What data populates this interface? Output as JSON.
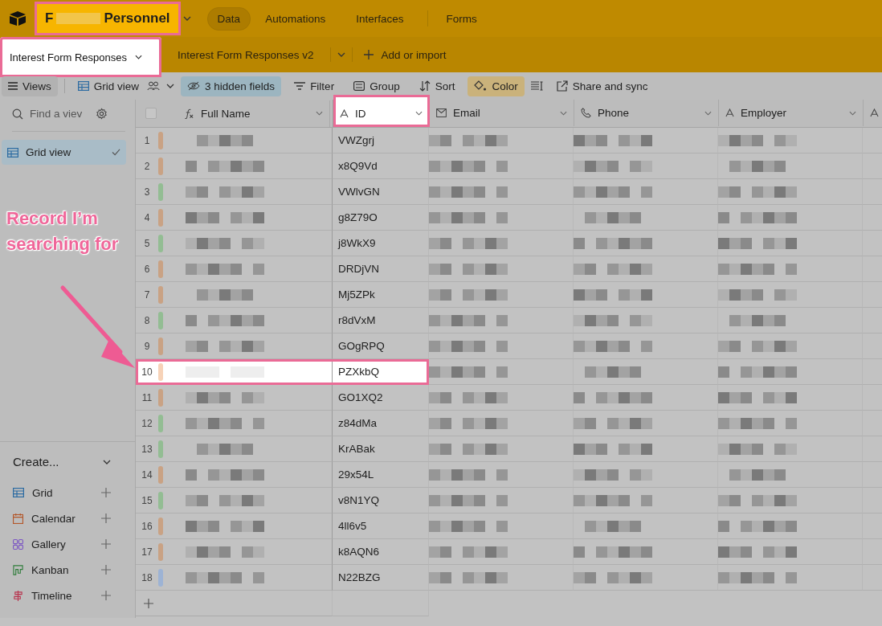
{
  "base": {
    "name_start": "F",
    "name_end": "Personnel",
    "highlighted": true
  },
  "nav": [
    {
      "label": "Data",
      "selected": true
    },
    {
      "label": "Automations",
      "selected": false
    },
    {
      "label": "Interfaces",
      "selected": false
    },
    {
      "label": "Forms",
      "selected": false
    }
  ],
  "tables": [
    {
      "label": "Interest Form Responses",
      "selected": true,
      "highlighted": true
    },
    {
      "label": "Interest Form Responses v2",
      "selected": false,
      "highlighted": false
    }
  ],
  "add_table": "Add or import",
  "toolbar": {
    "views": "Views",
    "view_name": "Grid view",
    "hidden_fields": "3 hidden fields",
    "filter": "Filter",
    "group": "Group",
    "sort": "Sort",
    "color_label": "Color",
    "color_active": true,
    "share": "Share and sync"
  },
  "sidebar": {
    "search_placeholder": "Find a viev",
    "views": [
      {
        "label": "Grid view",
        "selected": true
      }
    ],
    "create_label": "Create...",
    "create_items": [
      {
        "kind": "grid",
        "label": "Grid"
      },
      {
        "kind": "calendar",
        "label": "Calendar"
      },
      {
        "kind": "gallery",
        "label": "Gallery"
      },
      {
        "kind": "kanban",
        "label": "Kanban"
      },
      {
        "kind": "timeline",
        "label": "Timeline"
      }
    ]
  },
  "select_all": {
    "checked": false
  },
  "columns": [
    {
      "kind": "formula",
      "label": "Full Name",
      "highlighted": false
    },
    {
      "kind": "text",
      "label": "ID",
      "highlighted": true
    },
    {
      "kind": "email",
      "label": "Email",
      "highlighted": false
    },
    {
      "kind": "phone",
      "label": "Phone",
      "highlighted": false
    },
    {
      "kind": "text",
      "label": "Employer",
      "highlighted": false
    },
    {
      "kind": "text",
      "highlighted": false
    }
  ],
  "rows": [
    {
      "number": "1",
      "color": "#c9a284",
      "id": "VWZgrj",
      "highlighted": false
    },
    {
      "number": "2",
      "color": "#c9a284",
      "id": "x8Q9Vd",
      "highlighted": false
    },
    {
      "number": "3",
      "color": "#93bd93",
      "id": "VWlvGN",
      "highlighted": false
    },
    {
      "number": "4",
      "color": "#c9a284",
      "id": "g8Z79O",
      "highlighted": false
    },
    {
      "number": "5",
      "color": "#93bd93",
      "id": "j8WkX9",
      "highlighted": false
    },
    {
      "number": "6",
      "color": "#c9a284",
      "id": "DRDjVN",
      "highlighted": false
    },
    {
      "number": "7",
      "color": "#c9a284",
      "id": "Mj5ZPk",
      "highlighted": false
    },
    {
      "number": "8",
      "color": "#93bd93",
      "id": "r8dVxM",
      "highlighted": false
    },
    {
      "number": "9",
      "color": "#c9a284",
      "id": "GOgRPQ",
      "highlighted": false
    },
    {
      "number": "10",
      "color": "#f7d3b8",
      "id": "PZXkbQ",
      "highlighted": true
    },
    {
      "number": "11",
      "color": "#c9a284",
      "id": "GO1XQ2",
      "highlighted": false
    },
    {
      "number": "12",
      "color": "#93bd93",
      "id": "z84dMa",
      "highlighted": false
    },
    {
      "number": "13",
      "color": "#93bd93",
      "id": "KrABak",
      "highlighted": false
    },
    {
      "number": "14",
      "color": "#c9a284",
      "id": "29x54L",
      "highlighted": false
    },
    {
      "number": "15",
      "color": "#93bd93",
      "id": "v8N1YQ",
      "highlighted": false
    },
    {
      "number": "16",
      "color": "#c9a284",
      "id": "4ll6v5",
      "highlighted": false
    },
    {
      "number": "17",
      "color": "#c9a284",
      "id": "k8AQN6",
      "highlighted": false
    },
    {
      "number": "18",
      "color": "#9db3d4",
      "id": "N22BZG",
      "highlighted": false
    }
  ],
  "annotation": {
    "text": "Record I’m searching for"
  }
}
